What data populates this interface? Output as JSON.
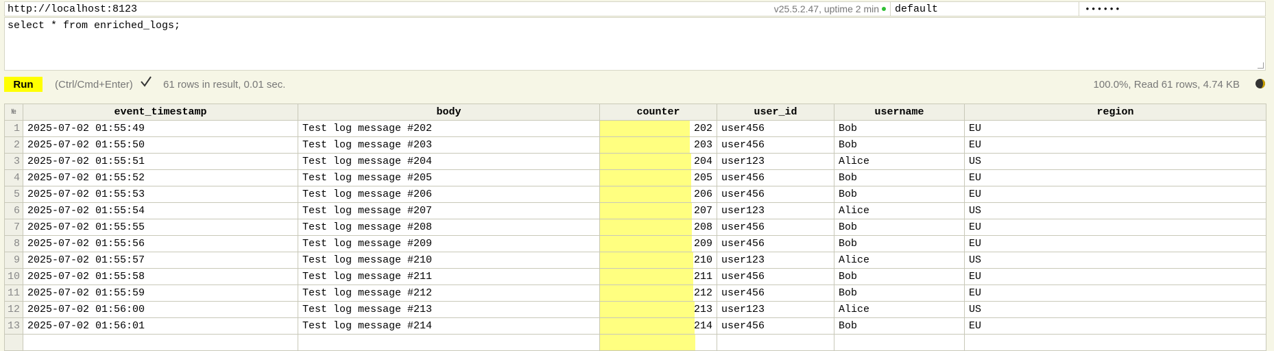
{
  "connection": {
    "url": "http://localhost:8123",
    "version": "v25.5.2.47, uptime 2 min",
    "user": "default",
    "password": "••••••"
  },
  "query": {
    "text": "select * from enriched_logs;"
  },
  "toolbar": {
    "run_label": "Run",
    "hint": "(Ctrl/Cmd+Enter)",
    "result_info": "61 rows in result, 0.01 sec.",
    "progress_info": "100.0%, Read 61 rows, 4.74 KB"
  },
  "table": {
    "rownum_header": "№",
    "columns": [
      "event_timestamp",
      "body",
      "counter",
      "user_id",
      "username",
      "region"
    ],
    "counter_bar_color": "#ffff80",
    "counter_bar_fractions": [
      0.77,
      0.77,
      0.78,
      0.78,
      0.78,
      0.79,
      0.79,
      0.79,
      0.8,
      0.8,
      0.8,
      0.81,
      0.81,
      0.82
    ],
    "rows": [
      {
        "n": "1",
        "event_timestamp": "2025-07-02 01:55:49",
        "body": "Test log message #202",
        "counter": "202",
        "user_id": "user456",
        "username": "Bob",
        "region": "EU"
      },
      {
        "n": "2",
        "event_timestamp": "2025-07-02 01:55:50",
        "body": "Test log message #203",
        "counter": "203",
        "user_id": "user456",
        "username": "Bob",
        "region": "EU"
      },
      {
        "n": "3",
        "event_timestamp": "2025-07-02 01:55:51",
        "body": "Test log message #204",
        "counter": "204",
        "user_id": "user123",
        "username": "Alice",
        "region": "US"
      },
      {
        "n": "4",
        "event_timestamp": "2025-07-02 01:55:52",
        "body": "Test log message #205",
        "counter": "205",
        "user_id": "user456",
        "username": "Bob",
        "region": "EU"
      },
      {
        "n": "5",
        "event_timestamp": "2025-07-02 01:55:53",
        "body": "Test log message #206",
        "counter": "206",
        "user_id": "user456",
        "username": "Bob",
        "region": "EU"
      },
      {
        "n": "6",
        "event_timestamp": "2025-07-02 01:55:54",
        "body": "Test log message #207",
        "counter": "207",
        "user_id": "user123",
        "username": "Alice",
        "region": "US"
      },
      {
        "n": "7",
        "event_timestamp": "2025-07-02 01:55:55",
        "body": "Test log message #208",
        "counter": "208",
        "user_id": "user456",
        "username": "Bob",
        "region": "EU"
      },
      {
        "n": "8",
        "event_timestamp": "2025-07-02 01:55:56",
        "body": "Test log message #209",
        "counter": "209",
        "user_id": "user456",
        "username": "Bob",
        "region": "EU"
      },
      {
        "n": "9",
        "event_timestamp": "2025-07-02 01:55:57",
        "body": "Test log message #210",
        "counter": "210",
        "user_id": "user123",
        "username": "Alice",
        "region": "US"
      },
      {
        "n": "10",
        "event_timestamp": "2025-07-02 01:55:58",
        "body": "Test log message #211",
        "counter": "211",
        "user_id": "user456",
        "username": "Bob",
        "region": "EU"
      },
      {
        "n": "11",
        "event_timestamp": "2025-07-02 01:55:59",
        "body": "Test log message #212",
        "counter": "212",
        "user_id": "user456",
        "username": "Bob",
        "region": "EU"
      },
      {
        "n": "12",
        "event_timestamp": "2025-07-02 01:56:00",
        "body": "Test log message #213",
        "counter": "213",
        "user_id": "user123",
        "username": "Alice",
        "region": "US"
      },
      {
        "n": "13",
        "event_timestamp": "2025-07-02 01:56:01",
        "body": "Test log message #214",
        "counter": "214",
        "user_id": "user456",
        "username": "Bob",
        "region": "EU"
      },
      {
        "n": "",
        "event_timestamp": "",
        "body": "",
        "counter": "",
        "user_id": "",
        "username": "",
        "region": ""
      }
    ]
  }
}
